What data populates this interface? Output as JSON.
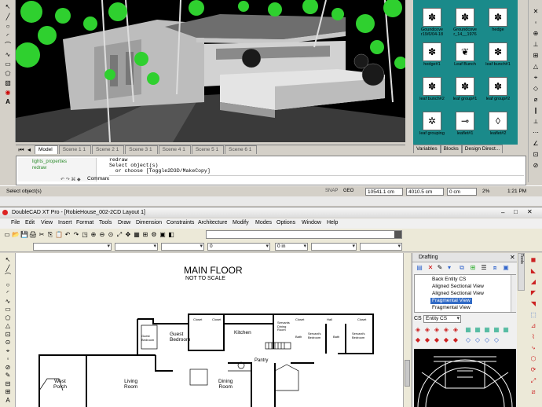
{
  "top_window": {
    "scene_tabs": [
      "Model",
      "Scene 1 1",
      "Scene 2 1",
      "Scene 3 1",
      "Scene 4 1",
      "Scene 5 1",
      "Scene 6 1"
    ],
    "symbols": [
      {
        "label": "Goundcove r19/6/04-18",
        "icon": "✽"
      },
      {
        "label": "Groundcove r_14__1976",
        "icon": "✽"
      },
      {
        "label": "hedge",
        "icon": "✽"
      },
      {
        "label": "hedge#1",
        "icon": "✽"
      },
      {
        "label": "Leaf Bunch",
        "icon": "❦"
      },
      {
        "label": "leaf bunch#1",
        "icon": "✽"
      },
      {
        "label": "leaf bunch#2",
        "icon": "✽"
      },
      {
        "label": "leaf group#1",
        "icon": "✽"
      },
      {
        "label": "leaf group#2",
        "icon": "✽"
      },
      {
        "label": "leaf grouping",
        "icon": "✲"
      },
      {
        "label": "leaflet#1",
        "icon": "⊸"
      },
      {
        "label": "leaflet#2",
        "icon": "◊"
      }
    ],
    "panel_tabs": [
      "Variables",
      "Blocks",
      "Design Direct..."
    ],
    "history_items": [
      "lights_properties",
      "redraw"
    ],
    "command_output": [
      "redraw",
      "Select object(s)",
      "  or choose [Toggle2D3D/MakeCopy]"
    ],
    "command_label": "Command:",
    "status_prompt": "Select object(s)",
    "snap": {
      "snap_label": "SNAP",
      "geo_label": "GEO",
      "x": "10541.1 cm",
      "y": "4010.5 cm",
      "z": "0 cm",
      "zoom": "2%",
      "time": "1:21 PM"
    }
  },
  "bottom_window": {
    "title": "DoubleCAD XT Pro - [RobieHouse_002-2CD Layout 1]",
    "menus": [
      "File",
      "Edit",
      "View",
      "Insert",
      "Format",
      "Tools",
      "Draw",
      "Dimension",
      "Constraints",
      "Architecture",
      "Modify",
      "Modes",
      "Options",
      "Window",
      "Help"
    ],
    "toolbar_inputs": {
      "field1": "0",
      "field2": "0 in"
    },
    "drafting": {
      "title": "Drafting",
      "tools_tab": "Tools",
      "tree_items": [
        "Back Entity CS",
        "Aligned Sectional View",
        "Aligned Sectional View",
        "Fragmental View",
        "Fragmental View"
      ],
      "selected_index": 3,
      "cs_label": "CS",
      "cs_value": "Entity CS"
    },
    "plan": {
      "title": "MAIN FLOOR",
      "subtitle": "NOT TO SCALE",
      "rooms": [
        {
          "name": "Guest Bedroom",
          "label": "Guest\nBedroom"
        },
        {
          "name": "Guest Bedroom small",
          "label": "Guest Bedroom"
        },
        {
          "name": "Kitchen",
          "label": "Kitchen"
        },
        {
          "name": "Servants Dining Room",
          "label": "Servants Dining Room"
        },
        {
          "name": "Servants Bedroom 1",
          "label": "Servant's Bedroom"
        },
        {
          "name": "Servants Bedroom 2",
          "label": "Servant's Bedroom"
        },
        {
          "name": "Bath 1",
          "label": "Bath"
        },
        {
          "name": "Bath 2",
          "label": "Bath"
        },
        {
          "name": "Pantry",
          "label": "Pantry"
        },
        {
          "name": "West Porch",
          "label": "West\nPorch"
        },
        {
          "name": "Living Room",
          "label": "Living\nRoom"
        },
        {
          "name": "Dining Room",
          "label": "Dining\nRoom"
        },
        {
          "name": "Closet 1",
          "label": "Closet"
        },
        {
          "name": "Closet 2",
          "label": "Closet"
        },
        {
          "name": "Closet 3",
          "label": "Closet"
        },
        {
          "name": "Hall",
          "label": "Hall"
        },
        {
          "name": "Closet 4",
          "label": "Closet"
        }
      ]
    }
  },
  "colors": {
    "symbol_panel": "#1a8a8a",
    "selection": "#316ac5",
    "viewport_bg": "#000000",
    "foliage": "#2fd02f"
  }
}
